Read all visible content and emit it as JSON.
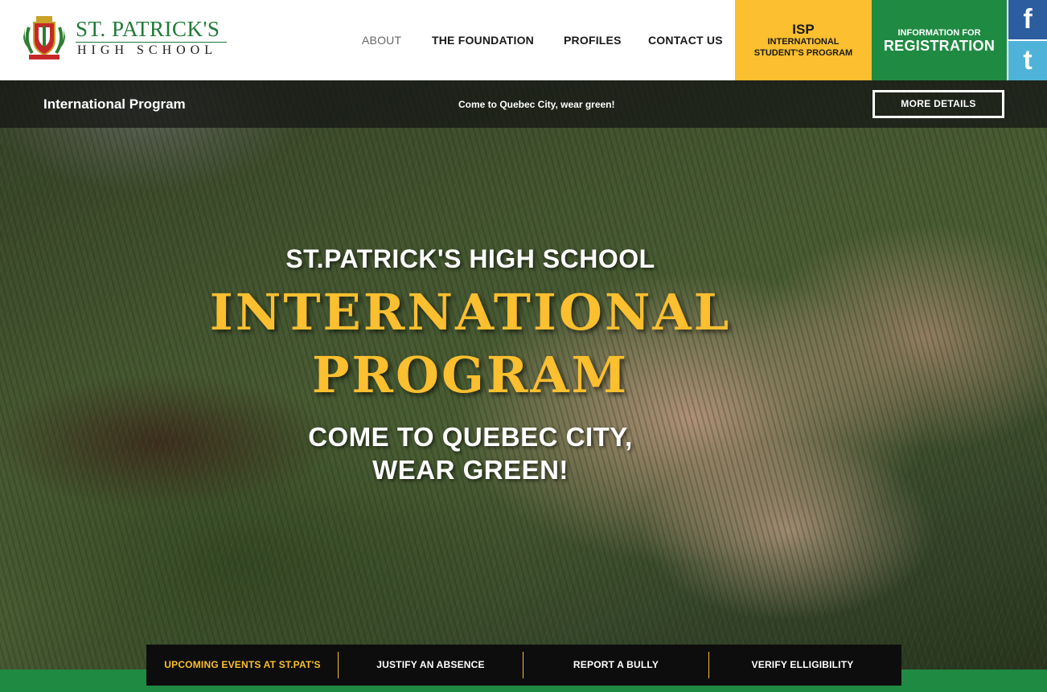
{
  "logo": {
    "name": "ST. PATRICK'S",
    "subtitle": "HIGH SCHOOL"
  },
  "nav": {
    "items": [
      {
        "label": "ABOUT",
        "active": true
      },
      {
        "label": "THE FOUNDATION",
        "active": false
      },
      {
        "label": "PROFILES",
        "active": false
      },
      {
        "label": "CONTACT US",
        "active": false
      }
    ]
  },
  "isp": {
    "title": "ISP",
    "line1": "INTERNATIONAL",
    "line2": "STUDENT'S PROGRAM"
  },
  "registration": {
    "small": "INFORMATION FOR",
    "big": "REGISTRATION"
  },
  "social": {
    "facebook_glyph": "f",
    "twitter_glyph": "t"
  },
  "ticker": {
    "title": "International Program",
    "message": "Come to Quebec City, wear green!",
    "button_label": "MORE DETAILS"
  },
  "hero": {
    "school": "ST.PATRICK'S HIGH SCHOOL",
    "line1": "INTERNATIONAL",
    "line2": "PROGRAM",
    "sub1": "COME TO QUEBEC CITY,",
    "sub2": "WEAR GREEN!"
  },
  "quick_links": [
    {
      "label": "UPCOMING EVENTS AT ST.PAT'S"
    },
    {
      "label": "JUSTIFY AN ABSENCE"
    },
    {
      "label": "REPORT A BULLY"
    },
    {
      "label": "VERIFY ELLIGIBILITY"
    }
  ],
  "colors": {
    "green": "#1f8a42",
    "gold": "#fbbf2f",
    "facebook": "#2b5d9f",
    "twitter": "#4fb3d9"
  }
}
